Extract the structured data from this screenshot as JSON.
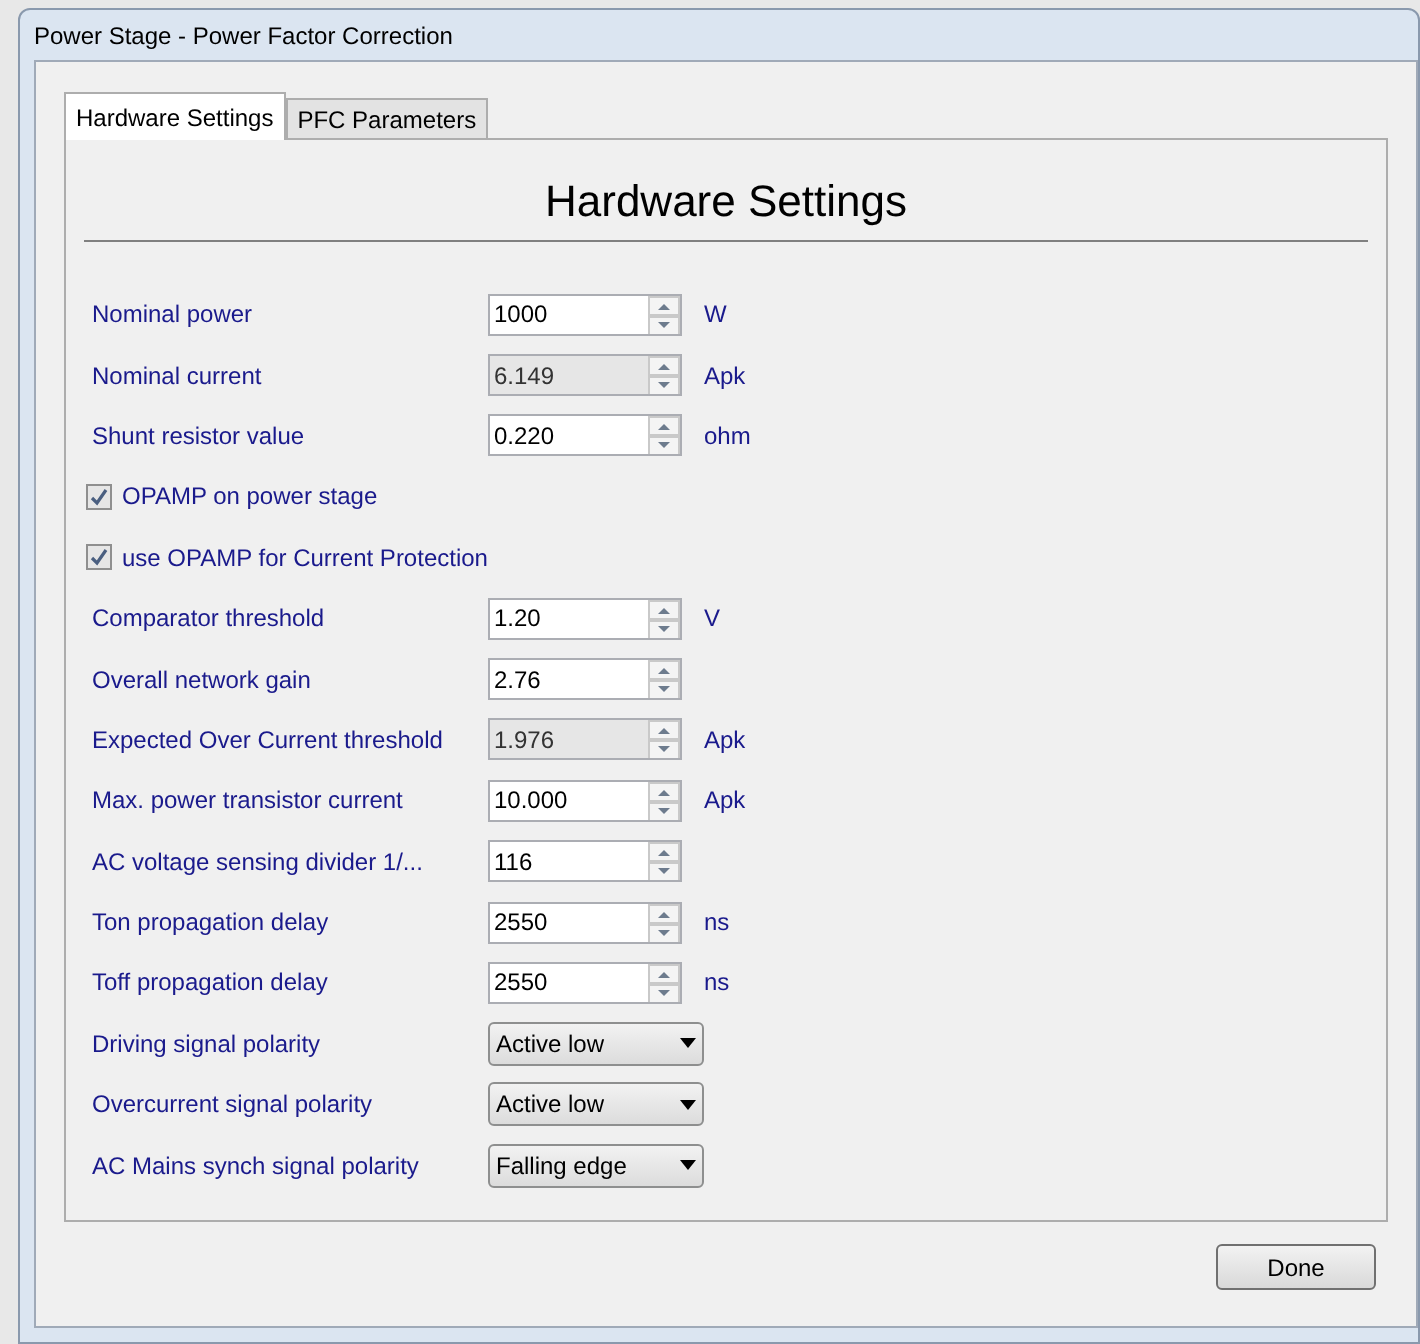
{
  "window": {
    "title": "Power Stage - Power Factor Correction"
  },
  "tabs": [
    {
      "label": "Hardware Settings",
      "selected": true
    },
    {
      "label": "PFC Parameters",
      "selected": false
    }
  ],
  "heading": "Hardware Settings",
  "rows": [
    {
      "kind": "spin",
      "label": "Nominal power",
      "value": "1000",
      "disabled": false,
      "unit": "W"
    },
    {
      "kind": "spin",
      "label": "Nominal current",
      "value": "6.149",
      "disabled": true,
      "unit": "Apk"
    },
    {
      "kind": "spin",
      "label": "Shunt resistor value",
      "value": "0.220",
      "disabled": false,
      "unit": "ohm"
    },
    {
      "kind": "check",
      "label": "OPAMP on power stage",
      "checked": true
    },
    {
      "kind": "check",
      "label": "use OPAMP for Current Protection",
      "checked": true
    },
    {
      "kind": "spin",
      "label": "Comparator threshold",
      "value": "1.20",
      "disabled": false,
      "unit": "V"
    },
    {
      "kind": "spin",
      "label": "Overall network gain",
      "value": "2.76",
      "disabled": false
    },
    {
      "kind": "spin",
      "label": "Expected Over Current threshold",
      "value": "1.976",
      "disabled": true,
      "unit": "Apk"
    },
    {
      "kind": "spin",
      "label": "Max. power transistor current",
      "value": "10.000",
      "disabled": false,
      "unit": "Apk"
    },
    {
      "kind": "spin",
      "label": "AC voltage sensing divider 1/...",
      "value": "116",
      "disabled": false
    },
    {
      "kind": "spin",
      "label": "Ton propagation delay",
      "value": "2550",
      "disabled": false,
      "unit": "ns"
    },
    {
      "kind": "spin",
      "label": "Toff propagation delay",
      "value": "2550",
      "disabled": false,
      "unit": "ns"
    },
    {
      "kind": "combo",
      "label": "Driving signal polarity",
      "value": "Active low"
    },
    {
      "kind": "combo",
      "label": "Overcurrent signal polarity",
      "value": "Active low"
    },
    {
      "kind": "combo",
      "label": "AC Mains synch signal polarity",
      "value": "Falling edge"
    }
  ],
  "buttons": [
    {
      "label": "Done"
    }
  ]
}
